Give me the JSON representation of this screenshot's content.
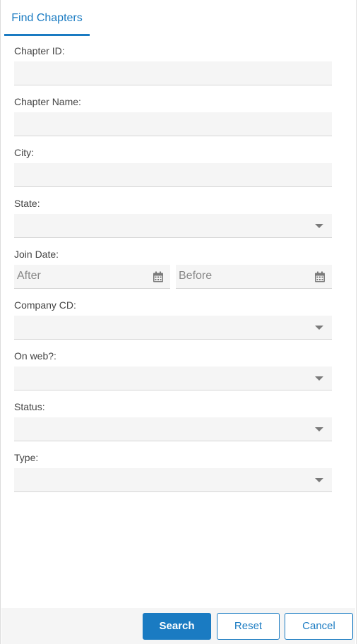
{
  "tab": {
    "label": "Find Chapters"
  },
  "fields": {
    "chapter_id": {
      "label": "Chapter ID:",
      "value": ""
    },
    "chapter_name": {
      "label": "Chapter Name:",
      "value": ""
    },
    "city": {
      "label": "City:",
      "value": ""
    },
    "state": {
      "label": "State:",
      "value": ""
    },
    "join_date": {
      "label": "Join Date:",
      "after_placeholder": "After",
      "before_placeholder": "Before"
    },
    "company_cd": {
      "label": "Company CD:",
      "value": ""
    },
    "on_web": {
      "label": "On web?:",
      "value": ""
    },
    "status": {
      "label": "Status:",
      "value": ""
    },
    "type": {
      "label": "Type:",
      "value": ""
    }
  },
  "buttons": {
    "search": "Search",
    "reset": "Reset",
    "cancel": "Cancel"
  },
  "icons": {
    "calendar": "calendar-icon",
    "dropdown": "chevron-down-icon"
  },
  "colors": {
    "accent": "#1a7bc2",
    "field_bg": "#f5f5f5",
    "footer_bg": "#f5f5f5"
  }
}
